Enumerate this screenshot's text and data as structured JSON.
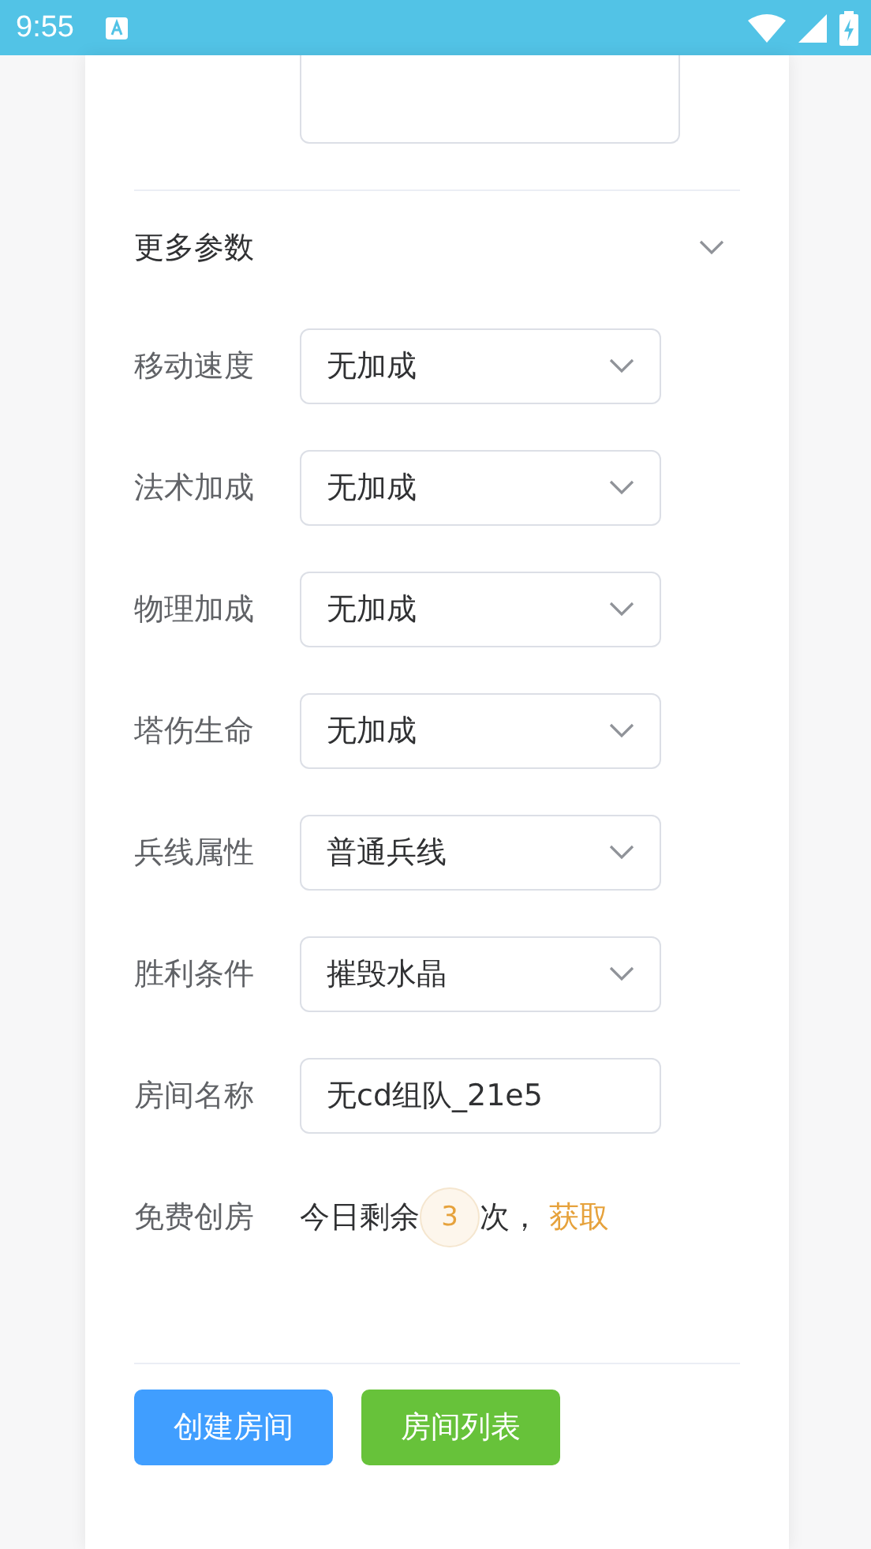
{
  "status_bar": {
    "time": "9:55"
  },
  "more_params": {
    "label": "更多参数",
    "expanded": true
  },
  "fields": [
    {
      "kind": "select",
      "label": "移动速度",
      "value": "无加成"
    },
    {
      "kind": "select",
      "label": "法术加成",
      "value": "无加成"
    },
    {
      "kind": "select",
      "label": "物理加成",
      "value": "无加成"
    },
    {
      "kind": "select",
      "label": "塔伤生命",
      "value": "无加成"
    },
    {
      "kind": "select",
      "label": "兵线属性",
      "value": "普通兵线"
    },
    {
      "kind": "select",
      "label": "胜利条件",
      "value": "摧毁水晶"
    },
    {
      "kind": "input",
      "label": "房间名称",
      "value": "无cd组队_21e5"
    }
  ],
  "free_create": {
    "label": "免费创房",
    "prefix": "今日剩余",
    "count": "3",
    "suffix": "次，",
    "link": "获取"
  },
  "buttons": [
    {
      "kind": "primary",
      "label": "创建房间"
    },
    {
      "kind": "success",
      "label": "房间列表"
    }
  ]
}
